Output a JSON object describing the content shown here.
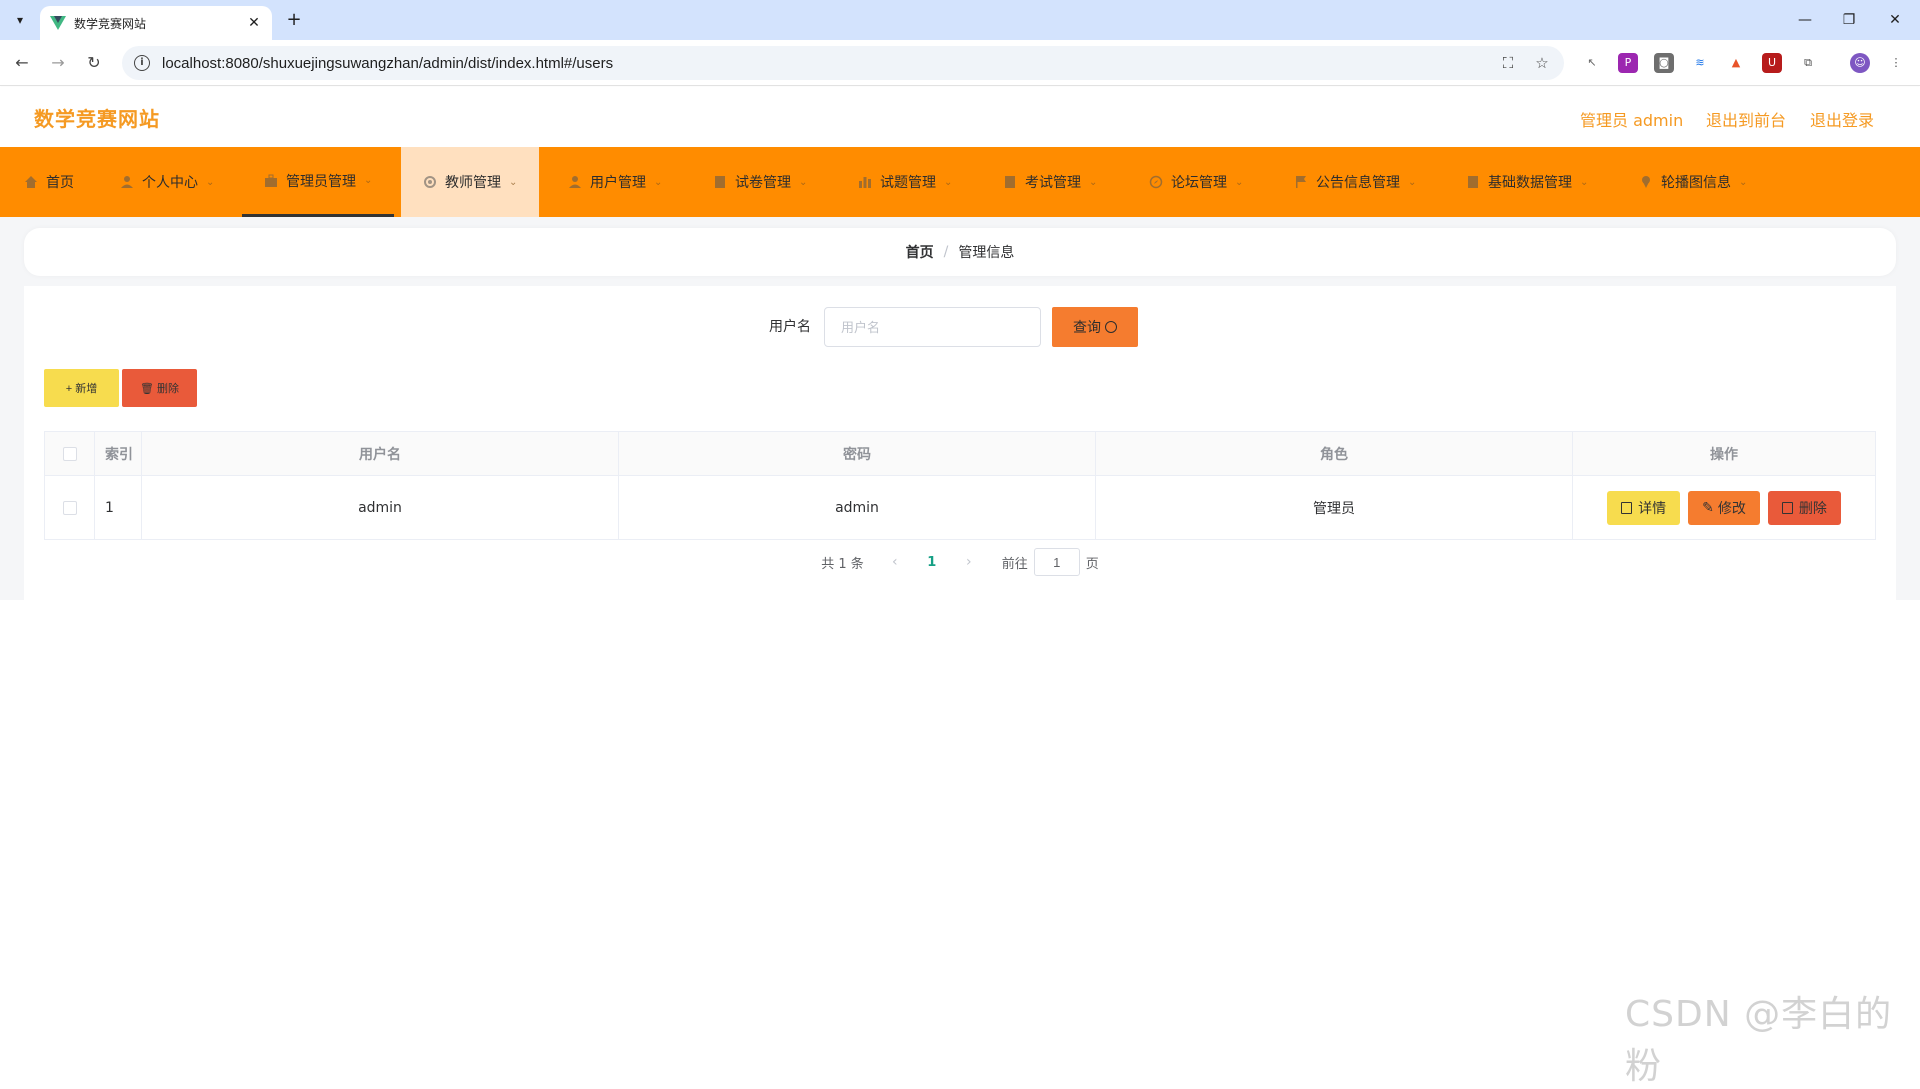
{
  "browser": {
    "tab_title": "数学竞赛网站",
    "url": "localhost:8080/shuxuejingsuwangzhan/admin/dist/index.html#/users",
    "accent": "#d3e3fd"
  },
  "header": {
    "title": "数学竞赛网站",
    "user_label": "管理员 admin",
    "to_front_label": "退出到前台",
    "logout_label": "退出登录",
    "brand_color": "#f59a23"
  },
  "nav": {
    "bg_color": "#ff8c00",
    "items": [
      {
        "label": "首页",
        "icon": "home-icon"
      },
      {
        "label": "个人中心",
        "icon": "user-icon"
      },
      {
        "label": "管理员管理",
        "icon": "briefcase-icon"
      },
      {
        "label": "教师管理",
        "icon": "gear-icon"
      },
      {
        "label": "用户管理",
        "icon": "user-icon"
      },
      {
        "label": "试卷管理",
        "icon": "doc-icon"
      },
      {
        "label": "试题管理",
        "icon": "chart-icon"
      },
      {
        "label": "考试管理",
        "icon": "doc-icon"
      },
      {
        "label": "论坛管理",
        "icon": "compass-icon"
      },
      {
        "label": "公告信息管理",
        "icon": "flag-icon"
      },
      {
        "label": "基础数据管理",
        "icon": "doc-icon"
      },
      {
        "label": "轮播图信息",
        "icon": "pin-icon"
      }
    ]
  },
  "breadcrumb": {
    "home": "首页",
    "separator": "/",
    "current": "管理信息"
  },
  "search": {
    "label": "用户名",
    "placeholder": "用户名",
    "button_label": "查询"
  },
  "actions": {
    "add_label": "+ 新增",
    "delete_label": "删除"
  },
  "table": {
    "headers": {
      "index": "索引",
      "username": "用户名",
      "password": "密码",
      "role": "角色",
      "ops": "操作"
    },
    "rows": [
      {
        "index": "1",
        "username": "admin",
        "password": "admin",
        "role": "管理员"
      }
    ],
    "op_detail": "详情",
    "op_edit": "修改",
    "op_delete": "删除"
  },
  "pagination": {
    "total_text": "共 1 条",
    "current_page": "1",
    "goto_label": "前往",
    "goto_value": "1",
    "page_suffix": "页"
  },
  "watermark": "CSDN @李白的粉"
}
